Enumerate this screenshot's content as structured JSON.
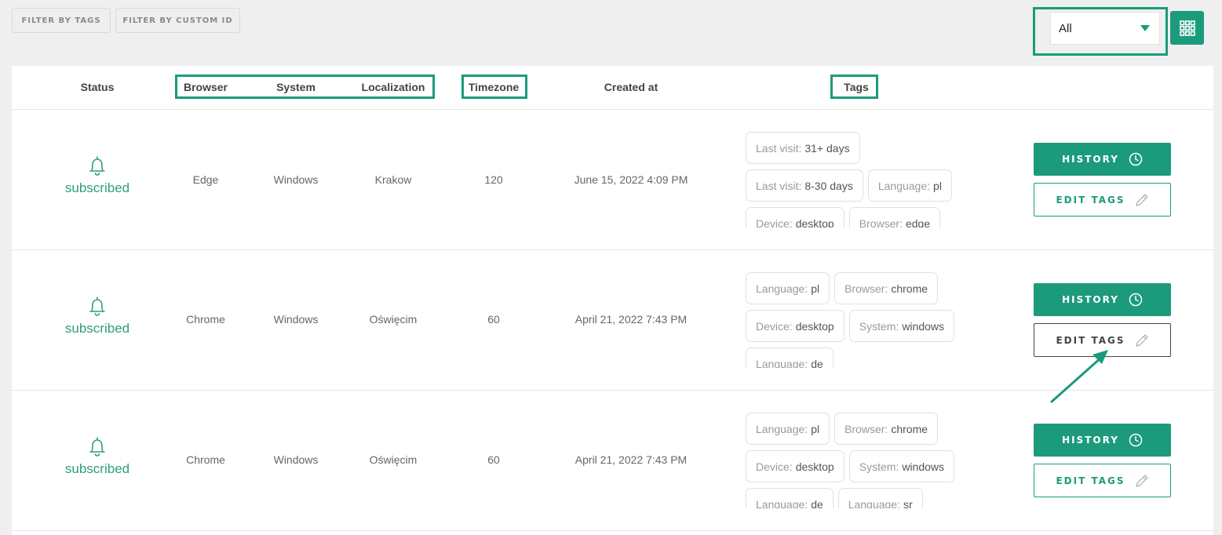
{
  "toolbar": {
    "filter_tags": "FILTER BY TAGS",
    "filter_custom_id": "FILTER BY CUSTOM ID",
    "select_value": "All"
  },
  "table": {
    "headers": {
      "status": "Status",
      "browser": "Browser",
      "system": "System",
      "localization": "Localization",
      "timezone": "Timezone",
      "created_at": "Created at",
      "tags": "Tags"
    },
    "history_label": "HISTORY",
    "edit_tags_label": "EDIT TAGS",
    "rows": [
      {
        "status": "subscribed",
        "browser": "Edge",
        "system": "Windows",
        "localization": "Krakow",
        "timezone": "120",
        "created_at": "June 15, 2022 4:09 PM",
        "tags": [
          {
            "k": "Last visit:",
            "v": "31+ days"
          },
          {
            "k": "Last visit:",
            "v": "8-30 days"
          },
          {
            "k": "Language:",
            "v": "pl"
          },
          {
            "k": "Device:",
            "v": "desktop"
          },
          {
            "k": "Browser:",
            "v": "edge"
          }
        ]
      },
      {
        "status": "subscribed",
        "browser": "Chrome",
        "system": "Windows",
        "localization": "Oświęcim",
        "timezone": "60",
        "created_at": "April 21, 2022 7:43 PM",
        "tags": [
          {
            "k": "Language:",
            "v": "pl"
          },
          {
            "k": "Browser:",
            "v": "chrome"
          },
          {
            "k": "Device:",
            "v": "desktop"
          },
          {
            "k": "System:",
            "v": "windows"
          },
          {
            "k": "Language:",
            "v": "de"
          }
        ]
      },
      {
        "status": "subscribed",
        "browser": "Chrome",
        "system": "Windows",
        "localization": "Oświęcim",
        "timezone": "60",
        "created_at": "April 21, 2022 7:43 PM",
        "tags": [
          {
            "k": "Language:",
            "v": "pl"
          },
          {
            "k": "Browser:",
            "v": "chrome"
          },
          {
            "k": "Device:",
            "v": "desktop"
          },
          {
            "k": "System:",
            "v": "windows"
          },
          {
            "k": "Language:",
            "v": "de"
          },
          {
            "k": "Language:",
            "v": "sr"
          }
        ]
      }
    ]
  },
  "colors": {
    "accent": "#1b9b7c",
    "background": "#efefef"
  },
  "icons": {
    "status": "bell-icon",
    "history": "clock-icon",
    "edit": "pencil-icon",
    "view_toggle": "grid-icon",
    "dropdown": "caret-down-icon"
  }
}
